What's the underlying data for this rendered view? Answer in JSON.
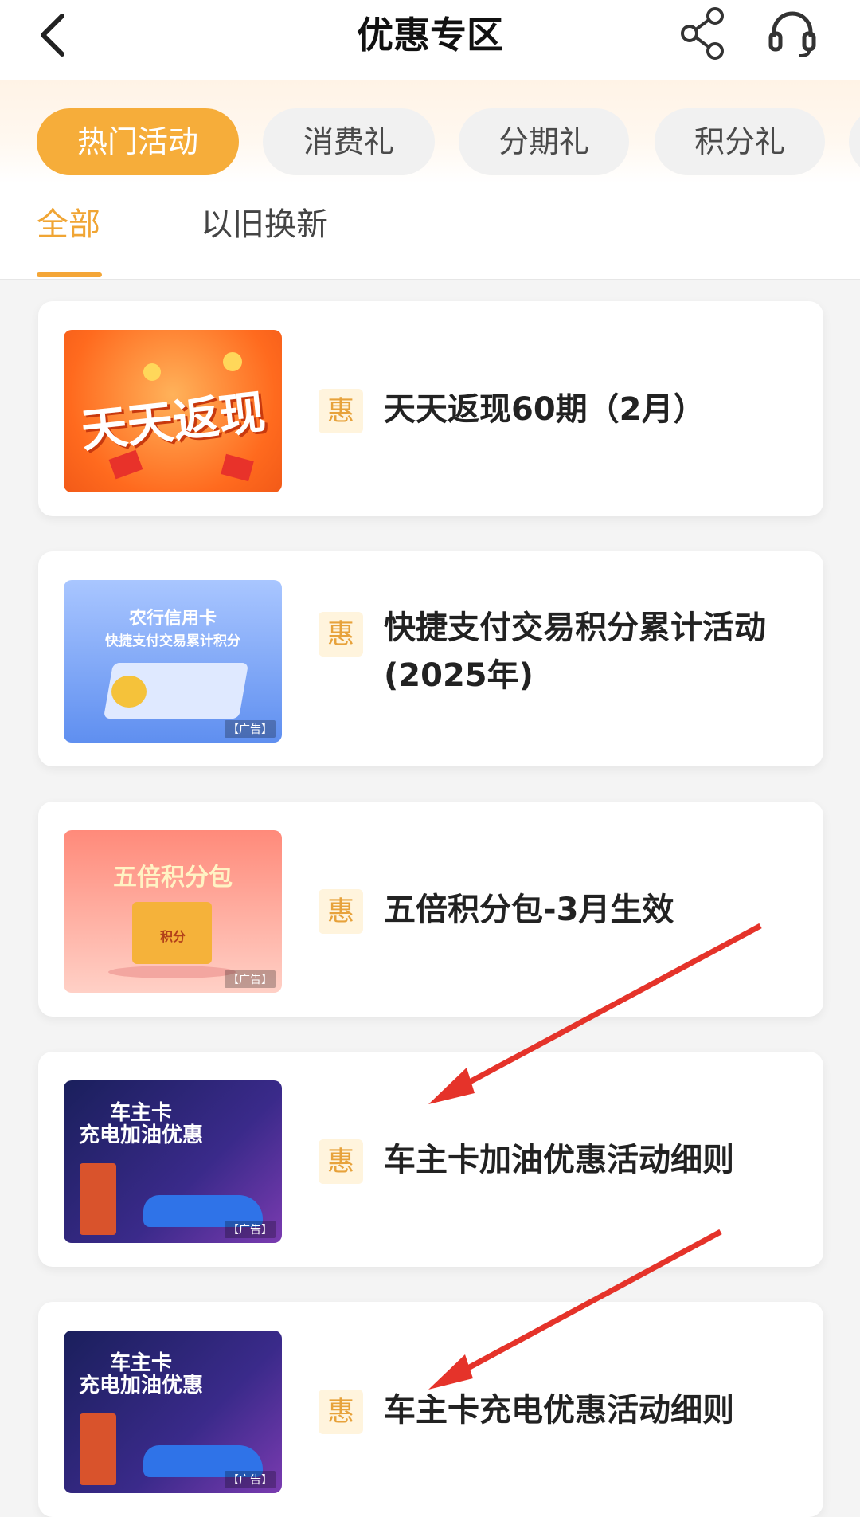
{
  "header": {
    "title": "优惠专区",
    "icons": [
      "back-arrow-icon",
      "share-icon",
      "customer-service-headset-icon"
    ]
  },
  "categories": [
    {
      "label": "热门活动",
      "active": true
    },
    {
      "label": "消费礼",
      "active": false
    },
    {
      "label": "分期礼",
      "active": false
    },
    {
      "label": "积分礼",
      "active": false
    }
  ],
  "subtabs": [
    {
      "label": "全部",
      "active": true
    },
    {
      "label": "以旧换新",
      "active": false
    }
  ],
  "badge": "惠",
  "items": [
    {
      "title": "天天返现60期（2月）",
      "image": {
        "text": "天天返现",
        "ad": ""
      }
    },
    {
      "title": "快捷支付交易积分累计活动(2025年)",
      "image": {
        "line1": "农行信用卡",
        "line2": "快捷支付交易累计积分",
        "ad": "【广告】"
      }
    },
    {
      "title": "五倍积分包-3月生效",
      "image": {
        "text": "五倍积分包",
        "tag": "积分",
        "ad": "【广告】"
      }
    },
    {
      "title": "车主卡加油优惠活动细则",
      "image": {
        "line1": "车主卡",
        "line2": "充电加油优惠",
        "ad": "【广告】"
      }
    },
    {
      "title": "车主卡充电优惠活动细则",
      "image": {
        "line1": "车主卡",
        "line2": "充电加油优惠",
        "ad": "【广告】"
      }
    }
  ],
  "colors": {
    "accent": "#f6ad3a",
    "annotation_arrow": "#e5332a"
  }
}
